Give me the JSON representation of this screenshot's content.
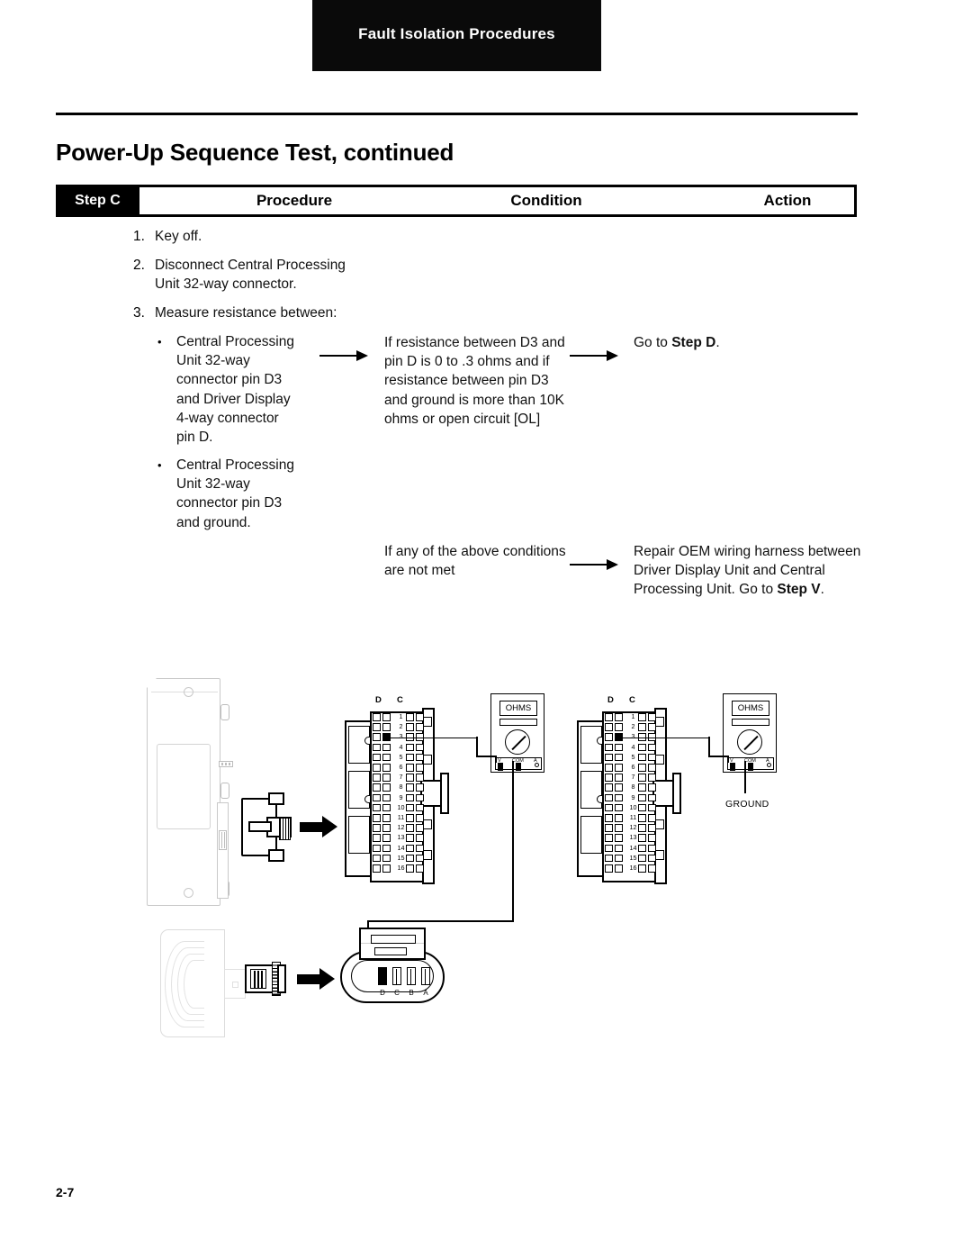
{
  "header": {
    "running_head": "Fault Isolation Procedures"
  },
  "section": {
    "title": "Power-Up Sequence Test, continued"
  },
  "table": {
    "step_label": "Step C",
    "columns": [
      "Procedure",
      "Condition",
      "Action"
    ],
    "procedure": {
      "n1": "1.",
      "step1": "Key off.",
      "n2": "2.",
      "step2": "Disconnect Central Processing\nUnit 32-way connector.",
      "n3": "3.",
      "step3": "Measure resistance between:",
      "bullet": "•",
      "bullet1": "Central Processing\nUnit 32-way\nconnector pin D3\nand Driver Display\n4-way connector\npin D.",
      "bullet2": "Central Processing\nUnit 32-way\nconnector pin D3\nand ground."
    },
    "condition": {
      "cond1": "If resistance between D3 and\npin D is 0 to .3 ohms and if\nresistance between pin D3\nand ground is more than 10K\nohms or open circuit [OL]",
      "cond2": "If any of the above conditions\nare not met"
    },
    "action": {
      "act1_pre": "Go to ",
      "act1_bold": "Step D",
      "act1_post": ".",
      "act2_pre": "Repair OEM wiring harness between\nDriver Display Unit and Central\nProcessing Unit. Go to ",
      "act2_bold": "Step V",
      "act2_post": "."
    }
  },
  "diagram": {
    "connector32": {
      "col_d": "D",
      "col_c": "C",
      "rows": [
        "1",
        "2",
        "3",
        "4",
        "5",
        "6",
        "7",
        "8",
        "9",
        "10",
        "11",
        "12",
        "13",
        "14",
        "15",
        "16"
      ],
      "highlighted_pin": "D3"
    },
    "meter_left": {
      "display": "OHMS",
      "jack_v": "V",
      "jack_com": "COM",
      "jack_a": "A"
    },
    "meter_right": {
      "display": "OHMS",
      "jack_v": "V",
      "jack_com": "COM",
      "jack_a": "A",
      "ground_label": "GROUND"
    },
    "connector4": {
      "pins": [
        "D",
        "C",
        "B",
        "A"
      ],
      "highlighted_pin": "D"
    }
  },
  "footer": {
    "page_number": "2-7"
  }
}
